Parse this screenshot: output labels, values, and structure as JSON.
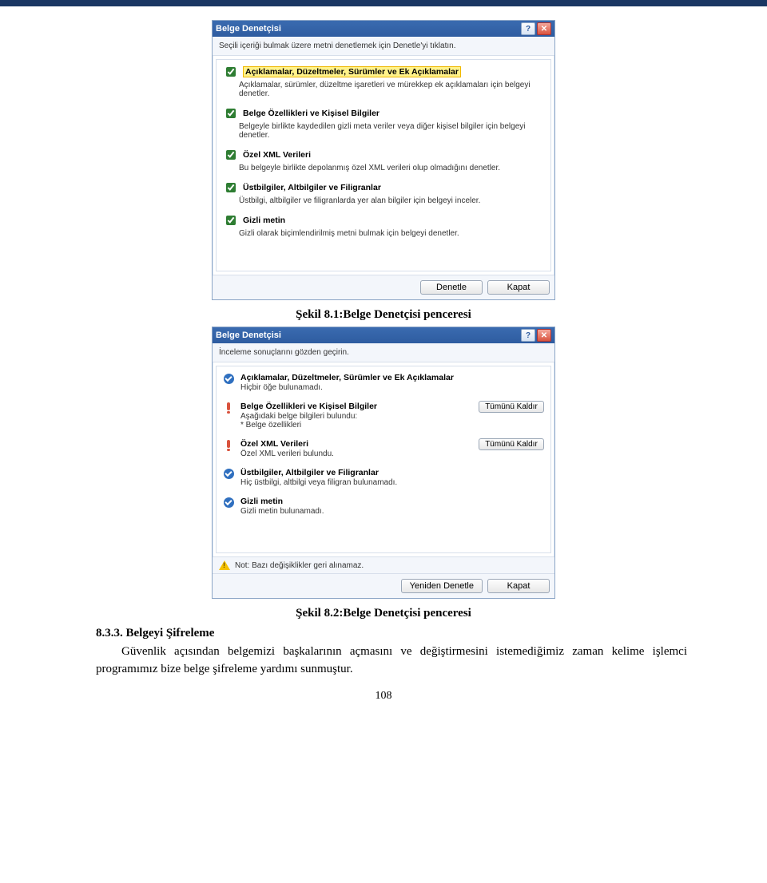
{
  "dialog1": {
    "title": "Belge Denetçisi",
    "instruction": "Seçili içeriği bulmak üzere metni denetlemek için Denetle'yi tıklatın.",
    "items": [
      {
        "label": "Açıklamalar, Düzeltmeler, Sürümler ve Ek Açıklamalar",
        "desc": "Açıklamalar, sürümler, düzeltme işaretleri ve mürekkep ek açıklamaları için belgeyi denetler.",
        "highlighted": true
      },
      {
        "label": "Belge Özellikleri ve Kişisel Bilgiler",
        "desc": "Belgeyle birlikte kaydedilen gizli meta veriler veya diğer kişisel bilgiler için belgeyi denetler."
      },
      {
        "label": "Özel XML Verileri",
        "desc": "Bu belgeyle birlikte depolanmış özel XML verileri olup olmadığını denetler."
      },
      {
        "label": "Üstbilgiler, Altbilgiler ve Filigranlar",
        "desc": "Üstbilgi, altbilgiler ve filigranlarda yer alan bilgiler için belgeyi inceler."
      },
      {
        "label": "Gizli metin",
        "desc": "Gizli olarak biçimlendirilmiş metni bulmak için belgeyi denetler."
      }
    ],
    "inspect_btn": "Denetle",
    "close_btn": "Kapat"
  },
  "caption1": "Şekil 8.1:Belge Denetçisi penceresi",
  "dialog2": {
    "title": "Belge Denetçisi",
    "instruction": "İnceleme sonuçlarını gözden geçirin.",
    "results": [
      {
        "icon": "check",
        "label": "Açıklamalar, Düzeltmeler, Sürümler ve Ek Açıklamalar",
        "desc": "Hiçbir öğe bulunamadı."
      },
      {
        "icon": "warn",
        "label": "Belge Özellikleri ve Kişisel Bilgiler",
        "desc": "Aşağıdaki belge bilgileri bulundu:\n* Belge özellikleri",
        "action": "Tümünü Kaldır"
      },
      {
        "icon": "warn",
        "label": "Özel XML Verileri",
        "desc": "Özel XML verileri bulundu.",
        "action": "Tümünü Kaldır"
      },
      {
        "icon": "check",
        "label": "Üstbilgiler, Altbilgiler ve Filigranlar",
        "desc": "Hiç üstbilgi, altbilgi veya filigran bulunamadı."
      },
      {
        "icon": "check",
        "label": "Gizli metin",
        "desc": "Gizli metin bulunamadı."
      }
    ],
    "note": "Not: Bazı değişiklikler geri alınamaz.",
    "reinspect_btn": "Yeniden Denetle",
    "close_btn": "Kapat"
  },
  "caption2": "Şekil 8.2:Belge Denetçisi penceresi",
  "section": "8.3.3. Belgeyi Şifreleme",
  "paragraph": "Güvenlik açısından belgemizi başkalarının açmasını ve değiştirmesini istemediğimiz zaman kelime işlemci programımız bize belge şifreleme yardımı sunmuştur.",
  "pageno": "108"
}
